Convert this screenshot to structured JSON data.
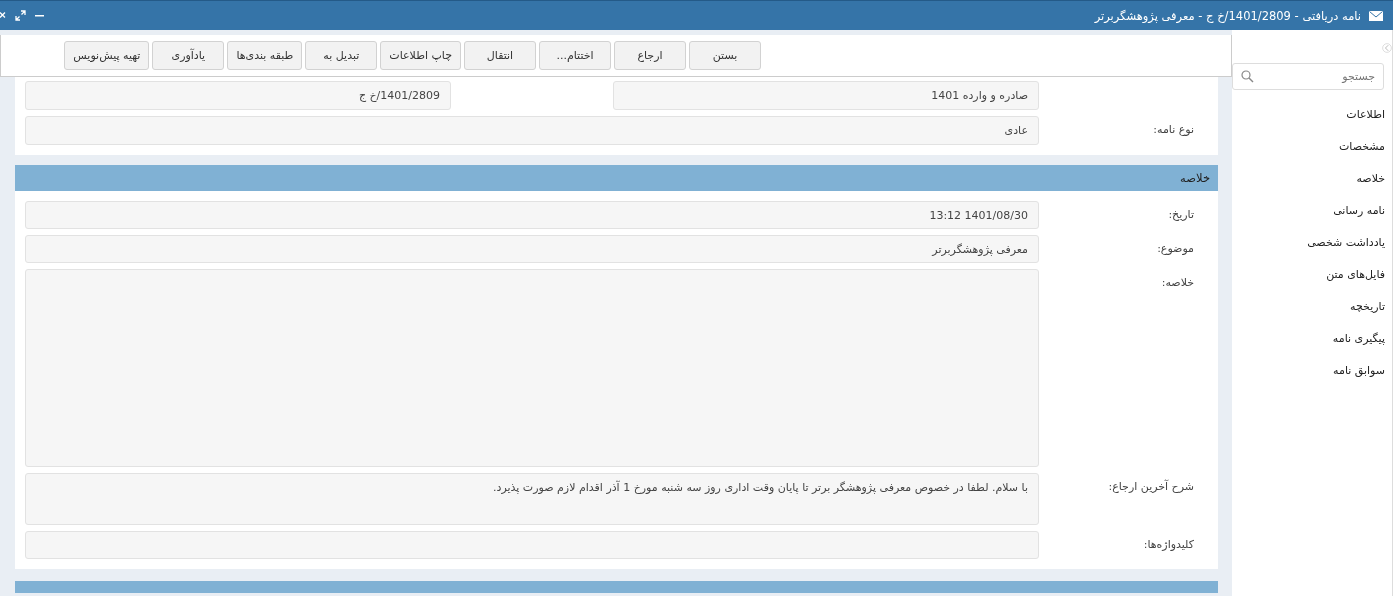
{
  "window": {
    "title": "نامه دریافتی - 1401/2809/خ ج - معرفی پژوهشگربرتر"
  },
  "toolbar": {
    "buttons": [
      "بستن",
      "ارجاع",
      "اختتام...",
      "انتقال",
      "چاپ اطلاعات",
      "تبدیل به",
      "طبقه بندی‌ها",
      "یادآوری",
      "تهیه پیش‌نویس"
    ]
  },
  "sidebar": {
    "search": {
      "placeholder": "جستجو"
    },
    "items": [
      "اطلاعات",
      "مشخصات",
      "خلاصه",
      "نامه رسانی",
      "یادداشت شخصی",
      "فایل‌های متن",
      "تاریخچه",
      "پیگیری نامه",
      "سوابق نامه"
    ]
  },
  "details": {
    "top_fields": [
      {
        "value": "صادره و وارده 1401"
      },
      {
        "value": "1401/2809/خ ج"
      }
    ],
    "letter_type": {
      "label": "نوع نامه:",
      "value": "عادی"
    }
  },
  "summary": {
    "title": "خلاصه",
    "fields": [
      {
        "label": "تاریخ:",
        "value": "1401/08/30 13:12",
        "kind": "line"
      },
      {
        "label": "موضوع:",
        "value": "معرفی پژوهشگربرتر",
        "kind": "line"
      },
      {
        "label": "خلاصه:",
        "kind": "area"
      },
      {
        "label": "شرح آخرین ارجاع:",
        "value": "با سلام. لطفا در خصوص معرفی پژوهشگر برتر تا پایان وقت اداری روز سه شنبه مورخ 1 آذر اقدام لازم صورت پذیرد.",
        "kind": "note"
      },
      {
        "label": "کلیدواژه‌ها:",
        "kind": "line"
      }
    ]
  }
}
